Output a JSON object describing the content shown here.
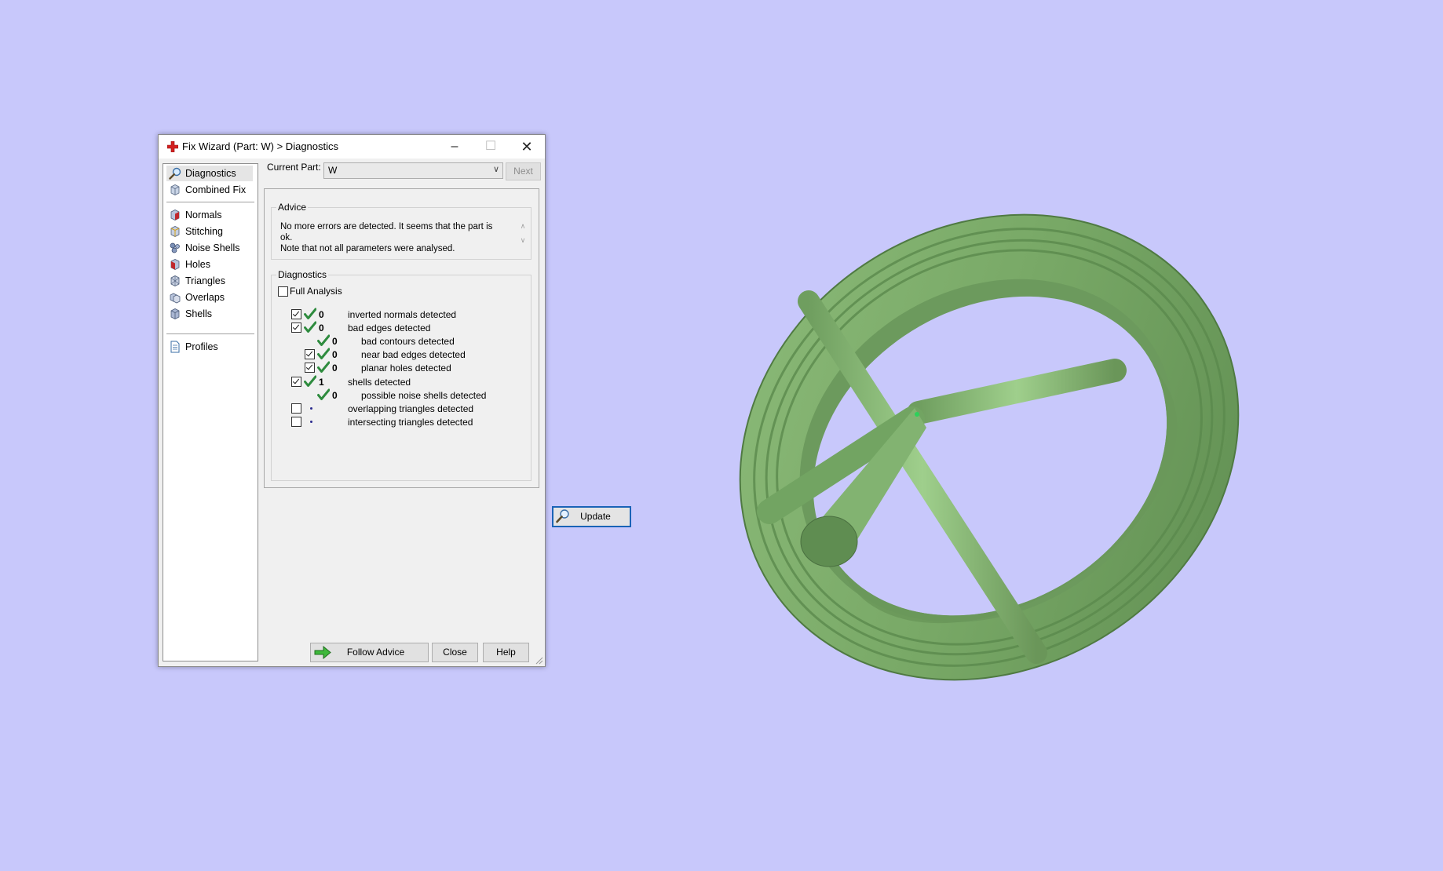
{
  "window": {
    "title": "Fix Wizard (Part: W) > Diagnostics",
    "controls": {
      "minimize": "–",
      "maximize": "☐",
      "close": "✕"
    }
  },
  "sidebar": {
    "items": [
      {
        "label": "Diagnostics",
        "icon": "magnifier-icon",
        "selected": true
      },
      {
        "label": "Combined Fix",
        "icon": "cube-icon"
      },
      {
        "label": "Normals",
        "icon": "normals-cube-icon"
      },
      {
        "label": "Stitching",
        "icon": "stitching-cube-icon"
      },
      {
        "label": "Noise Shells",
        "icon": "noise-shells-icon"
      },
      {
        "label": "Holes",
        "icon": "holes-cube-icon"
      },
      {
        "label": "Triangles",
        "icon": "triangles-cube-icon"
      },
      {
        "label": "Overlaps",
        "icon": "overlaps-cube-icon"
      },
      {
        "label": "Shells",
        "icon": "shells-cube-icon"
      },
      {
        "label": "Profiles",
        "icon": "document-icon"
      }
    ]
  },
  "current_part": {
    "label": "Current Part:",
    "value": "W",
    "next": "Next"
  },
  "advice": {
    "legend": "Advice",
    "line1": "No more errors are detected. It seems that the part is ok.",
    "line2": "Note that not all parameters were analysed."
  },
  "diagnostics": {
    "legend": "Diagnostics",
    "full_analysis": {
      "label": "Full Analysis",
      "checked": false
    },
    "rows": [
      {
        "checkbox": true,
        "checked": true,
        "status": "ok",
        "count": "0",
        "label": "inverted normals detected",
        "indent": 0
      },
      {
        "checkbox": true,
        "checked": true,
        "status": "ok",
        "count": "0",
        "label": "bad edges detected",
        "indent": 0
      },
      {
        "checkbox": false,
        "checked": false,
        "status": "ok",
        "count": "0",
        "label": "bad contours detected",
        "indent": 1
      },
      {
        "checkbox": true,
        "checked": true,
        "status": "ok",
        "count": "0",
        "label": "near bad edges detected",
        "indent": 1
      },
      {
        "checkbox": true,
        "checked": true,
        "status": "ok",
        "count": "0",
        "label": "planar holes detected",
        "indent": 1
      },
      {
        "checkbox": true,
        "checked": true,
        "status": "ok",
        "count": "1",
        "label": "shells detected",
        "indent": 0
      },
      {
        "checkbox": false,
        "checked": false,
        "status": "ok",
        "count": "0",
        "label": "possible noise shells detected",
        "indent": 1
      },
      {
        "checkbox": true,
        "checked": false,
        "status": "dot",
        "count": "",
        "label": "overlapping triangles detected",
        "indent": 0
      },
      {
        "checkbox": true,
        "checked": false,
        "status": "dot",
        "count": "",
        "label": "intersecting triangles detected",
        "indent": 0
      }
    ],
    "update": "Update"
  },
  "footer": {
    "follow_advice": "Follow Advice",
    "close": "Close",
    "help": "Help"
  },
  "colors": {
    "viewport_bg": "#c8c8fb",
    "model_green": "#7aa86a",
    "tick_green": "#2e8b3e",
    "focus_blue": "#1a63b7"
  }
}
